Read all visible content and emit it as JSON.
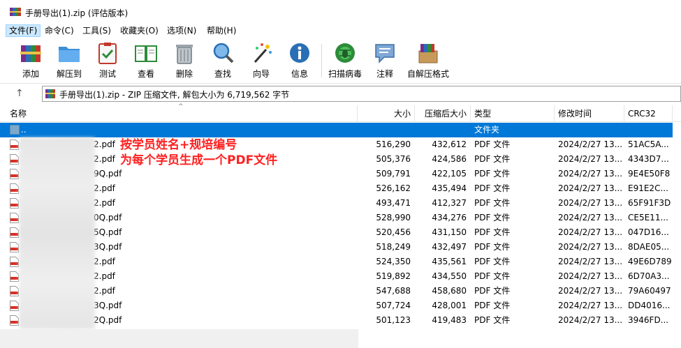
{
  "window": {
    "title": "手册导出(1).zip (评估版本)"
  },
  "menu": [
    {
      "label": "文件(F)",
      "active": true
    },
    {
      "label": "命令(C)"
    },
    {
      "label": "工具(S)"
    },
    {
      "label": "收藏夹(O)"
    },
    {
      "label": "选项(N)"
    },
    {
      "label": "帮助(H)"
    }
  ],
  "toolbar": [
    {
      "label": "添加",
      "icon": "winrar-books-icon"
    },
    {
      "label": "解压到",
      "icon": "folder-extract-icon"
    },
    {
      "label": "测试",
      "icon": "clipboard-check-icon"
    },
    {
      "label": "查看",
      "icon": "open-book-icon"
    },
    {
      "label": "删除",
      "icon": "trash-can-icon"
    },
    {
      "label": "查找",
      "icon": "magnifier-icon"
    },
    {
      "label": "向导",
      "icon": "magic-wand-icon"
    },
    {
      "label": "信息",
      "icon": "info-icon"
    },
    {
      "label": "扫描病毒",
      "icon": "virus-scan-icon"
    },
    {
      "label": "注释",
      "icon": "comment-icon"
    },
    {
      "label": "自解压格式",
      "icon": "sfx-box-icon"
    }
  ],
  "address": {
    "text": "手册导出(1).zip - ZIP 压缩文件, 解包大小为 6,719,562 字节"
  },
  "columns": {
    "name": "名称",
    "size": "大小",
    "packed": "压缩后大小",
    "type": "类型",
    "modified": "修改时间",
    "crc": "CRC32"
  },
  "parent_row": {
    "name": "..",
    "type": "文件夹"
  },
  "files": [
    {
      "name_suffix": "2.pdf",
      "size": "516,290",
      "packed": "432,612",
      "type": "PDF 文件",
      "modified": "2024/2/27 13...",
      "crc": "51AC5A..."
    },
    {
      "name_suffix": "2.pdf",
      "size": "505,376",
      "packed": "424,586",
      "type": "PDF 文件",
      "modified": "2024/2/27 13...",
      "crc": "4343D7..."
    },
    {
      "name_suffix": "9Q.pdf",
      "size": "509,791",
      "packed": "422,105",
      "type": "PDF 文件",
      "modified": "2024/2/27 13...",
      "crc": "9E4E50F8"
    },
    {
      "name_suffix": "2.pdf",
      "size": "526,162",
      "packed": "435,494",
      "type": "PDF 文件",
      "modified": "2024/2/27 13...",
      "crc": "E91E2C..."
    },
    {
      "name_suffix": "2.pdf",
      "size": "493,471",
      "packed": "412,327",
      "type": "PDF 文件",
      "modified": "2024/2/27 13...",
      "crc": "65F91F3D"
    },
    {
      "name_suffix": "0Q.pdf",
      "size": "528,990",
      "packed": "434,276",
      "type": "PDF 文件",
      "modified": "2024/2/27 13...",
      "crc": "CE5E11..."
    },
    {
      "name_suffix": "5Q.pdf",
      "size": "520,456",
      "packed": "431,150",
      "type": "PDF 文件",
      "modified": "2024/2/27 13...",
      "crc": "047D16..."
    },
    {
      "name_suffix": "3Q.pdf",
      "size": "518,249",
      "packed": "432,497",
      "type": "PDF 文件",
      "modified": "2024/2/27 13...",
      "crc": "8DAE05..."
    },
    {
      "name_suffix": "2.pdf",
      "size": "524,350",
      "packed": "435,561",
      "type": "PDF 文件",
      "modified": "2024/2/27 13...",
      "crc": "49E6D789"
    },
    {
      "name_suffix": "2.pdf",
      "size": "519,892",
      "packed": "434,550",
      "type": "PDF 文件",
      "modified": "2024/2/27 13...",
      "crc": "6D70A3..."
    },
    {
      "name_suffix": "2.pdf",
      "size": "547,688",
      "packed": "458,680",
      "type": "PDF 文件",
      "modified": "2024/2/27 13...",
      "crc": "79A60497"
    },
    {
      "name_suffix": "3Q.pdf",
      "size": "507,724",
      "packed": "428,001",
      "type": "PDF 文件",
      "modified": "2024/2/27 13...",
      "crc": "DD4016..."
    },
    {
      "name_suffix": "2Q.pdf",
      "size": "501,123",
      "packed": "419,483",
      "type": "PDF 文件",
      "modified": "2024/2/27 13...",
      "crc": "3946FD..."
    }
  ],
  "annotation": {
    "line1": "按学员姓名+规培编号",
    "line2": "为每个学员生成一个PDF文件",
    "color": "#ff2020"
  },
  "colors": {
    "selection": "#0078d7",
    "menu_active_bg": "#cce8ff"
  }
}
